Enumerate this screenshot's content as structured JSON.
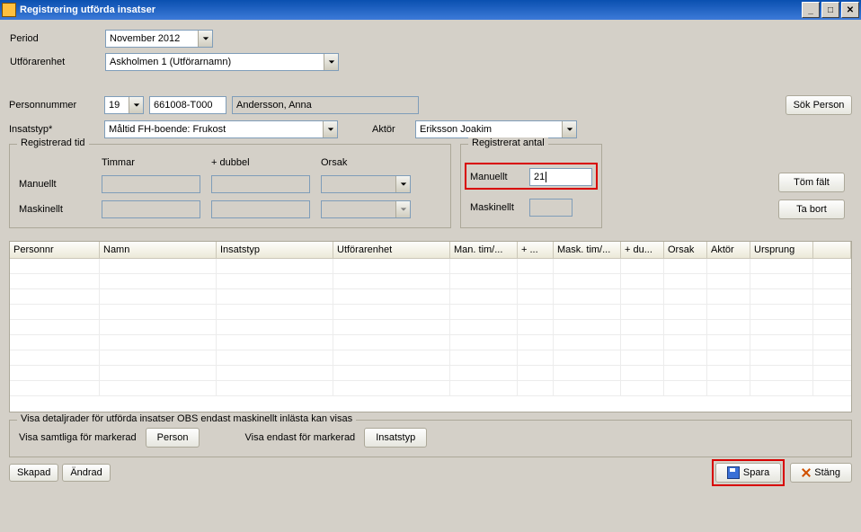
{
  "window": {
    "title": "Registrering utförda insatser"
  },
  "header": {
    "period_label": "Period",
    "period_value": "November 2012",
    "unit_label": "Utförarenhet",
    "unit_value": "Askholmen 1 (Utförarnamn)"
  },
  "person": {
    "pnr_label": "Personnummer",
    "century": "19",
    "pnr": "661008-T000",
    "name": "Andersson, Anna",
    "search_btn": "Sök Person",
    "insatstyp_label": "Insatstyp*",
    "insatstyp_value": "Måltid FH-boende: Frukost",
    "aktor_label": "Aktör",
    "aktor_value": "Eriksson Joakim"
  },
  "buttons": {
    "clear": "Töm fält",
    "remove": "Ta bort",
    "save": "Spara",
    "close": "Stäng",
    "created": "Skapad",
    "changed": "Ändrad",
    "person": "Person",
    "insatstyp": "Insatstyp"
  },
  "reg_tid": {
    "group": "Registrerad tid",
    "timmar": "Timmar",
    "dubbel": "+ dubbel",
    "orsak": "Orsak",
    "manuellt": "Manuellt",
    "maskinellt": "Maskinellt"
  },
  "reg_antal": {
    "group": "Registrerat antal",
    "manuellt": "Manuellt",
    "maskinellt": "Maskinellt",
    "manuellt_value": "21"
  },
  "table_headers": {
    "c0": "Personnr",
    "c1": "Namn",
    "c2": "Insatstyp",
    "c3": "Utförarenhet",
    "c4": "Man. tim/...",
    "c5": "+ ...",
    "c6": "Mask. tim/...",
    "c7": "+ du...",
    "c8": "Orsak",
    "c9": "Aktör",
    "c10": "Ursprung"
  },
  "detail_group": {
    "title": "Visa detaljrader för utförda insatser OBS endast maskinellt inlästa kan visas",
    "show_all": "Visa samtliga för markerad",
    "show_only": "Visa endast för markerad"
  }
}
